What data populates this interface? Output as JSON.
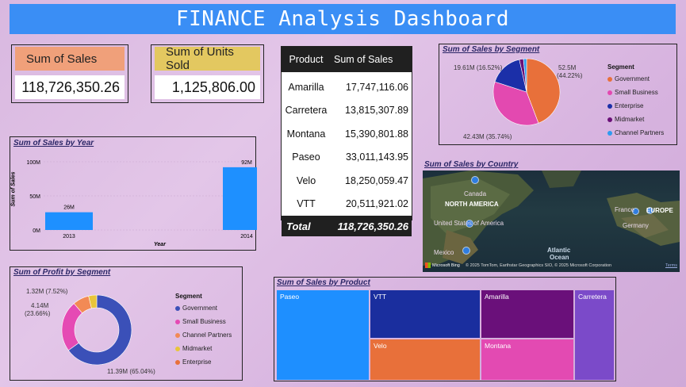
{
  "title": "FINANCE Analysis Dashboard",
  "cards": {
    "sales": {
      "label": "Sum of Sales",
      "value": "118,726,350.26",
      "color": "#f0a07a"
    },
    "units": {
      "label": "Sum of Units Sold",
      "value": "1,125,806.00",
      "color": "#e3c860"
    }
  },
  "table": {
    "headers": [
      "Product",
      "Sum of Sales"
    ],
    "rows": [
      {
        "product": "Amarilla",
        "sales": "17,747,116.06"
      },
      {
        "product": "Carretera",
        "sales": "13,815,307.89"
      },
      {
        "product": "Montana",
        "sales": "15,390,801.88"
      },
      {
        "product": "Paseo",
        "sales": "33,011,143.95"
      },
      {
        "product": "Velo",
        "sales": "18,250,059.47"
      },
      {
        "product": "VTT",
        "sales": "20,511,921.02"
      }
    ],
    "total_label": "Total",
    "total_value": "118,726,350.26"
  },
  "pie_segment": {
    "title": "Sum of Sales by Segment",
    "legend_title": "Segment",
    "legend": [
      "Government",
      "Small Business",
      "Enterprise",
      "Midmarket",
      "Channel Partners"
    ],
    "labels": {
      "gov": "52.5M",
      "gov_pct": "(44.22%)",
      "sb": "42.43M (35.74%)",
      "ent": "19.61M (16.52%)"
    }
  },
  "bar_year": {
    "title": "Sum of Sales by Year",
    "ylabel": "Sum of Sales",
    "xlabel": "Year",
    "yticks": [
      "100M",
      "50M",
      "0M"
    ],
    "data_labels": [
      "26M",
      "92M"
    ]
  },
  "map": {
    "title": "Sum of Sales by Country",
    "labels": {
      "canada": "Canada",
      "north_america": "NORTH AMERICA",
      "usa": "United States of America",
      "mexico": "Mexico",
      "france": "France",
      "europe": "EUROPE",
      "germany": "Germany",
      "atlantic": "Atlantic",
      "ocean": "Ocean",
      "credits": "© 2025 TomTom, Earthstar Geographics SIO, © 2025 Microsoft Corporation",
      "brand": "Microsoft Bing",
      "terms": "Terms"
    }
  },
  "donut_profit": {
    "title": "Sum of Profit by Segment",
    "legend_title": "Segment",
    "legend": [
      "Government",
      "Small Business",
      "Channel Partners",
      "Midmarket",
      "Enterprise"
    ],
    "labels": {
      "l1": "1.32M (7.52%)",
      "l2a": "4.14M",
      "l2b": "(23.66%)",
      "l3": "11.39M (65.04%)"
    }
  },
  "treemap": {
    "title": "Sum of Sales by Product",
    "tiles": [
      "Paseo",
      "VTT",
      "Velo",
      "Amarilla",
      "Montana",
      "Carretera"
    ]
  },
  "colors": {
    "government": "#e8703a",
    "small_business": "#e349b0",
    "enterprise": "#1b2fa8",
    "midmarket": "#6a1078",
    "channel_partners": "#2f9bf0",
    "donut_government": "#3b50b8",
    "donut_small_business": "#e54ab4",
    "donut_channel": "#f28a55",
    "donut_midmarket": "#e8c53a",
    "bar": "#1e90ff"
  },
  "chart_data": [
    {
      "type": "pie",
      "title": "Sum of Sales by Segment",
      "categories": [
        "Government",
        "Small Business",
        "Enterprise",
        "Midmarket",
        "Channel Partners"
      ],
      "values": [
        52.5,
        42.43,
        19.61,
        2.38,
        1.8
      ]
    },
    {
      "type": "bar",
      "title": "Sum of Sales by Year",
      "categories": [
        "2013",
        "2014"
      ],
      "values": [
        26,
        92
      ],
      "xlabel": "Year",
      "ylabel": "Sum of Sales",
      "ylim": [
        0,
        100
      ]
    },
    {
      "type": "pie",
      "title": "Sum of Profit by Segment",
      "categories": [
        "Government",
        "Small Business",
        "Channel Partners",
        "Midmarket",
        "Enterprise"
      ],
      "values": [
        11.39,
        4.14,
        1.32,
        0.66,
        0.0
      ]
    },
    {
      "type": "table",
      "title": "Sum of Sales by Product",
      "categories": [
        "Paseo",
        "VTT",
        "Velo",
        "Amarilla",
        "Montana",
        "Carretera"
      ],
      "values": [
        33011143.95,
        20511921.02,
        18250059.47,
        17747116.06,
        15390801.88,
        13815307.89
      ]
    }
  ]
}
